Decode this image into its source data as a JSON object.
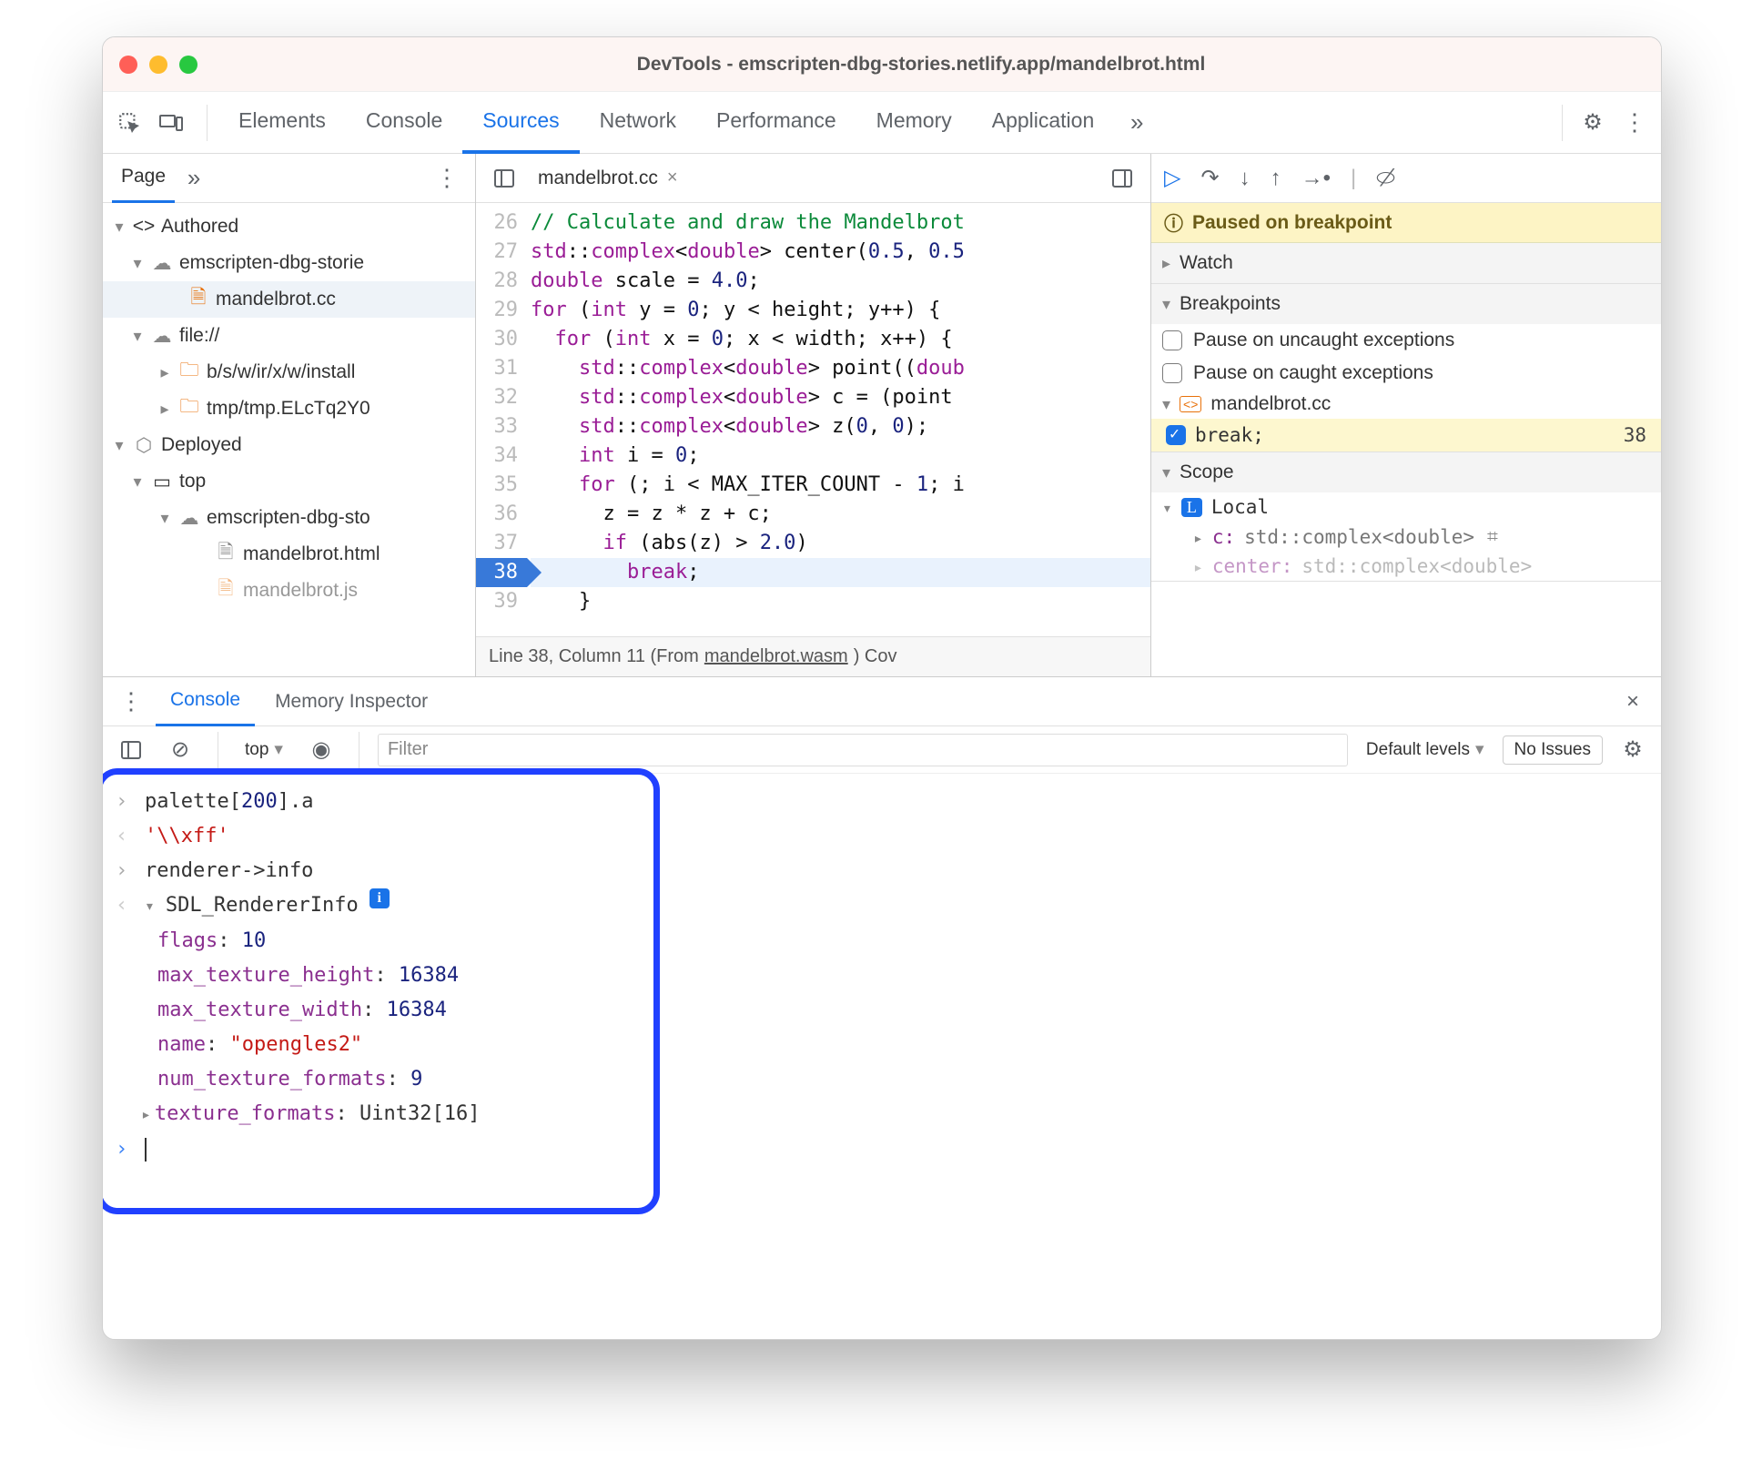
{
  "window": {
    "title": "DevTools - emscripten-dbg-stories.netlify.app/mandelbrot.html"
  },
  "tabs": {
    "items": [
      "Elements",
      "Console",
      "Sources",
      "Network",
      "Performance",
      "Memory",
      "Application"
    ],
    "active": "Sources"
  },
  "nav": {
    "tab": "Page",
    "tree": {
      "authored": "Authored",
      "site": "emscripten-dbg-storie",
      "file1": "mandelbrot.cc",
      "local": "file://",
      "folder1": "b/s/w/ir/x/w/install",
      "folder2": "tmp/tmp.ELcTq2Y0",
      "deployed": "Deployed",
      "top": "top",
      "site2": "emscripten-dbg-sto",
      "html": "mandelbrot.html",
      "js": "mandelbrot.js"
    }
  },
  "editor": {
    "tab": "mandelbrot.cc",
    "lines": [
      {
        "n": 26,
        "html": "<span class='cm'>// Calculate and draw the Mandelbrot</span>"
      },
      {
        "n": 27,
        "html": "<span class='ns'>std</span>::<span class='ns'>complex</span>&lt;<span class='kw'>double</span>&gt; center(<span class='num'>0.5</span>, <span class='num'>0.5</span>"
      },
      {
        "n": 28,
        "html": "<span class='kw'>double</span> scale = <span class='num'>4.0</span>;"
      },
      {
        "n": 29,
        "html": "<span class='kw'>for</span> (<span class='kw'>int</span> y = <span class='num'>0</span>; y &lt; height; y++) {"
      },
      {
        "n": 30,
        "html": "  <span class='kw'>for</span> (<span class='kw'>int</span> x = <span class='num'>0</span>; x &lt; width; x++) {"
      },
      {
        "n": 31,
        "html": "    <span class='ns'>std</span>::<span class='ns'>complex</span>&lt;<span class='kw'>double</span>&gt; point((<span class='kw'>doub</span>"
      },
      {
        "n": 32,
        "html": "    <span class='ns'>std</span>::<span class='ns'>complex</span>&lt;<span class='kw'>double</span>&gt; c = (point "
      },
      {
        "n": 33,
        "html": "    <span class='ns'>std</span>::<span class='ns'>complex</span>&lt;<span class='kw'>double</span>&gt; z(<span class='num'>0</span>, <span class='num'>0</span>);"
      },
      {
        "n": 34,
        "html": "    <span class='kw'>int</span> i = <span class='num'>0</span>;"
      },
      {
        "n": 35,
        "html": "    <span class='kw'>for</span> (; i &lt; MAX_ITER_COUNT - <span class='num'>1</span>; i"
      },
      {
        "n": 36,
        "html": "      z = z * z + c;"
      },
      {
        "n": 37,
        "html": "      <span class='kw'>if</span> (abs(z) &gt; <span class='num'>2.0</span>)"
      },
      {
        "n": 38,
        "html": "        <span class='kw'>break</span>;",
        "current": true
      },
      {
        "n": 39,
        "html": "    }"
      }
    ],
    "status_prefix": "Line 38, Column 11  (From ",
    "status_link": "mandelbrot.wasm",
    "status_suffix": ")  Cov"
  },
  "debug": {
    "banner": "Paused on breakpoint",
    "watch": "Watch",
    "breakpoints": "Breakpoints",
    "ex1": "Pause on uncaught exceptions",
    "ex2": "Pause on caught exceptions",
    "bp_file": "mandelbrot.cc",
    "bp_code": "break;",
    "bp_ln": "38",
    "scope": "Scope",
    "local": "Local",
    "scope_c_name": "c:",
    "scope_c_val": "std::complex<double>",
    "scope_center_name": "center:",
    "scope_center_val": "std::complex<double>"
  },
  "drawer": {
    "tabs": [
      "Console",
      "Memory Inspector"
    ],
    "context": "top",
    "filter_ph": "Filter",
    "levels": "Default levels",
    "noissues": "No Issues"
  },
  "console": {
    "in1": "palette[200].a",
    "out1": "'\\\\xff'",
    "in2": "renderer->info",
    "objname": "SDL_RendererInfo",
    "fields": [
      {
        "k": "flags",
        "v": "10",
        "t": "num"
      },
      {
        "k": "max_texture_height",
        "v": "16384",
        "t": "num"
      },
      {
        "k": "max_texture_width",
        "v": "16384",
        "t": "num"
      },
      {
        "k": "name",
        "v": "\"opengles2\"",
        "t": "str"
      },
      {
        "k": "num_texture_formats",
        "v": "9",
        "t": "num"
      },
      {
        "k": "texture_formats",
        "v": "Uint32[16]",
        "t": "type",
        "arrow": true
      }
    ]
  }
}
